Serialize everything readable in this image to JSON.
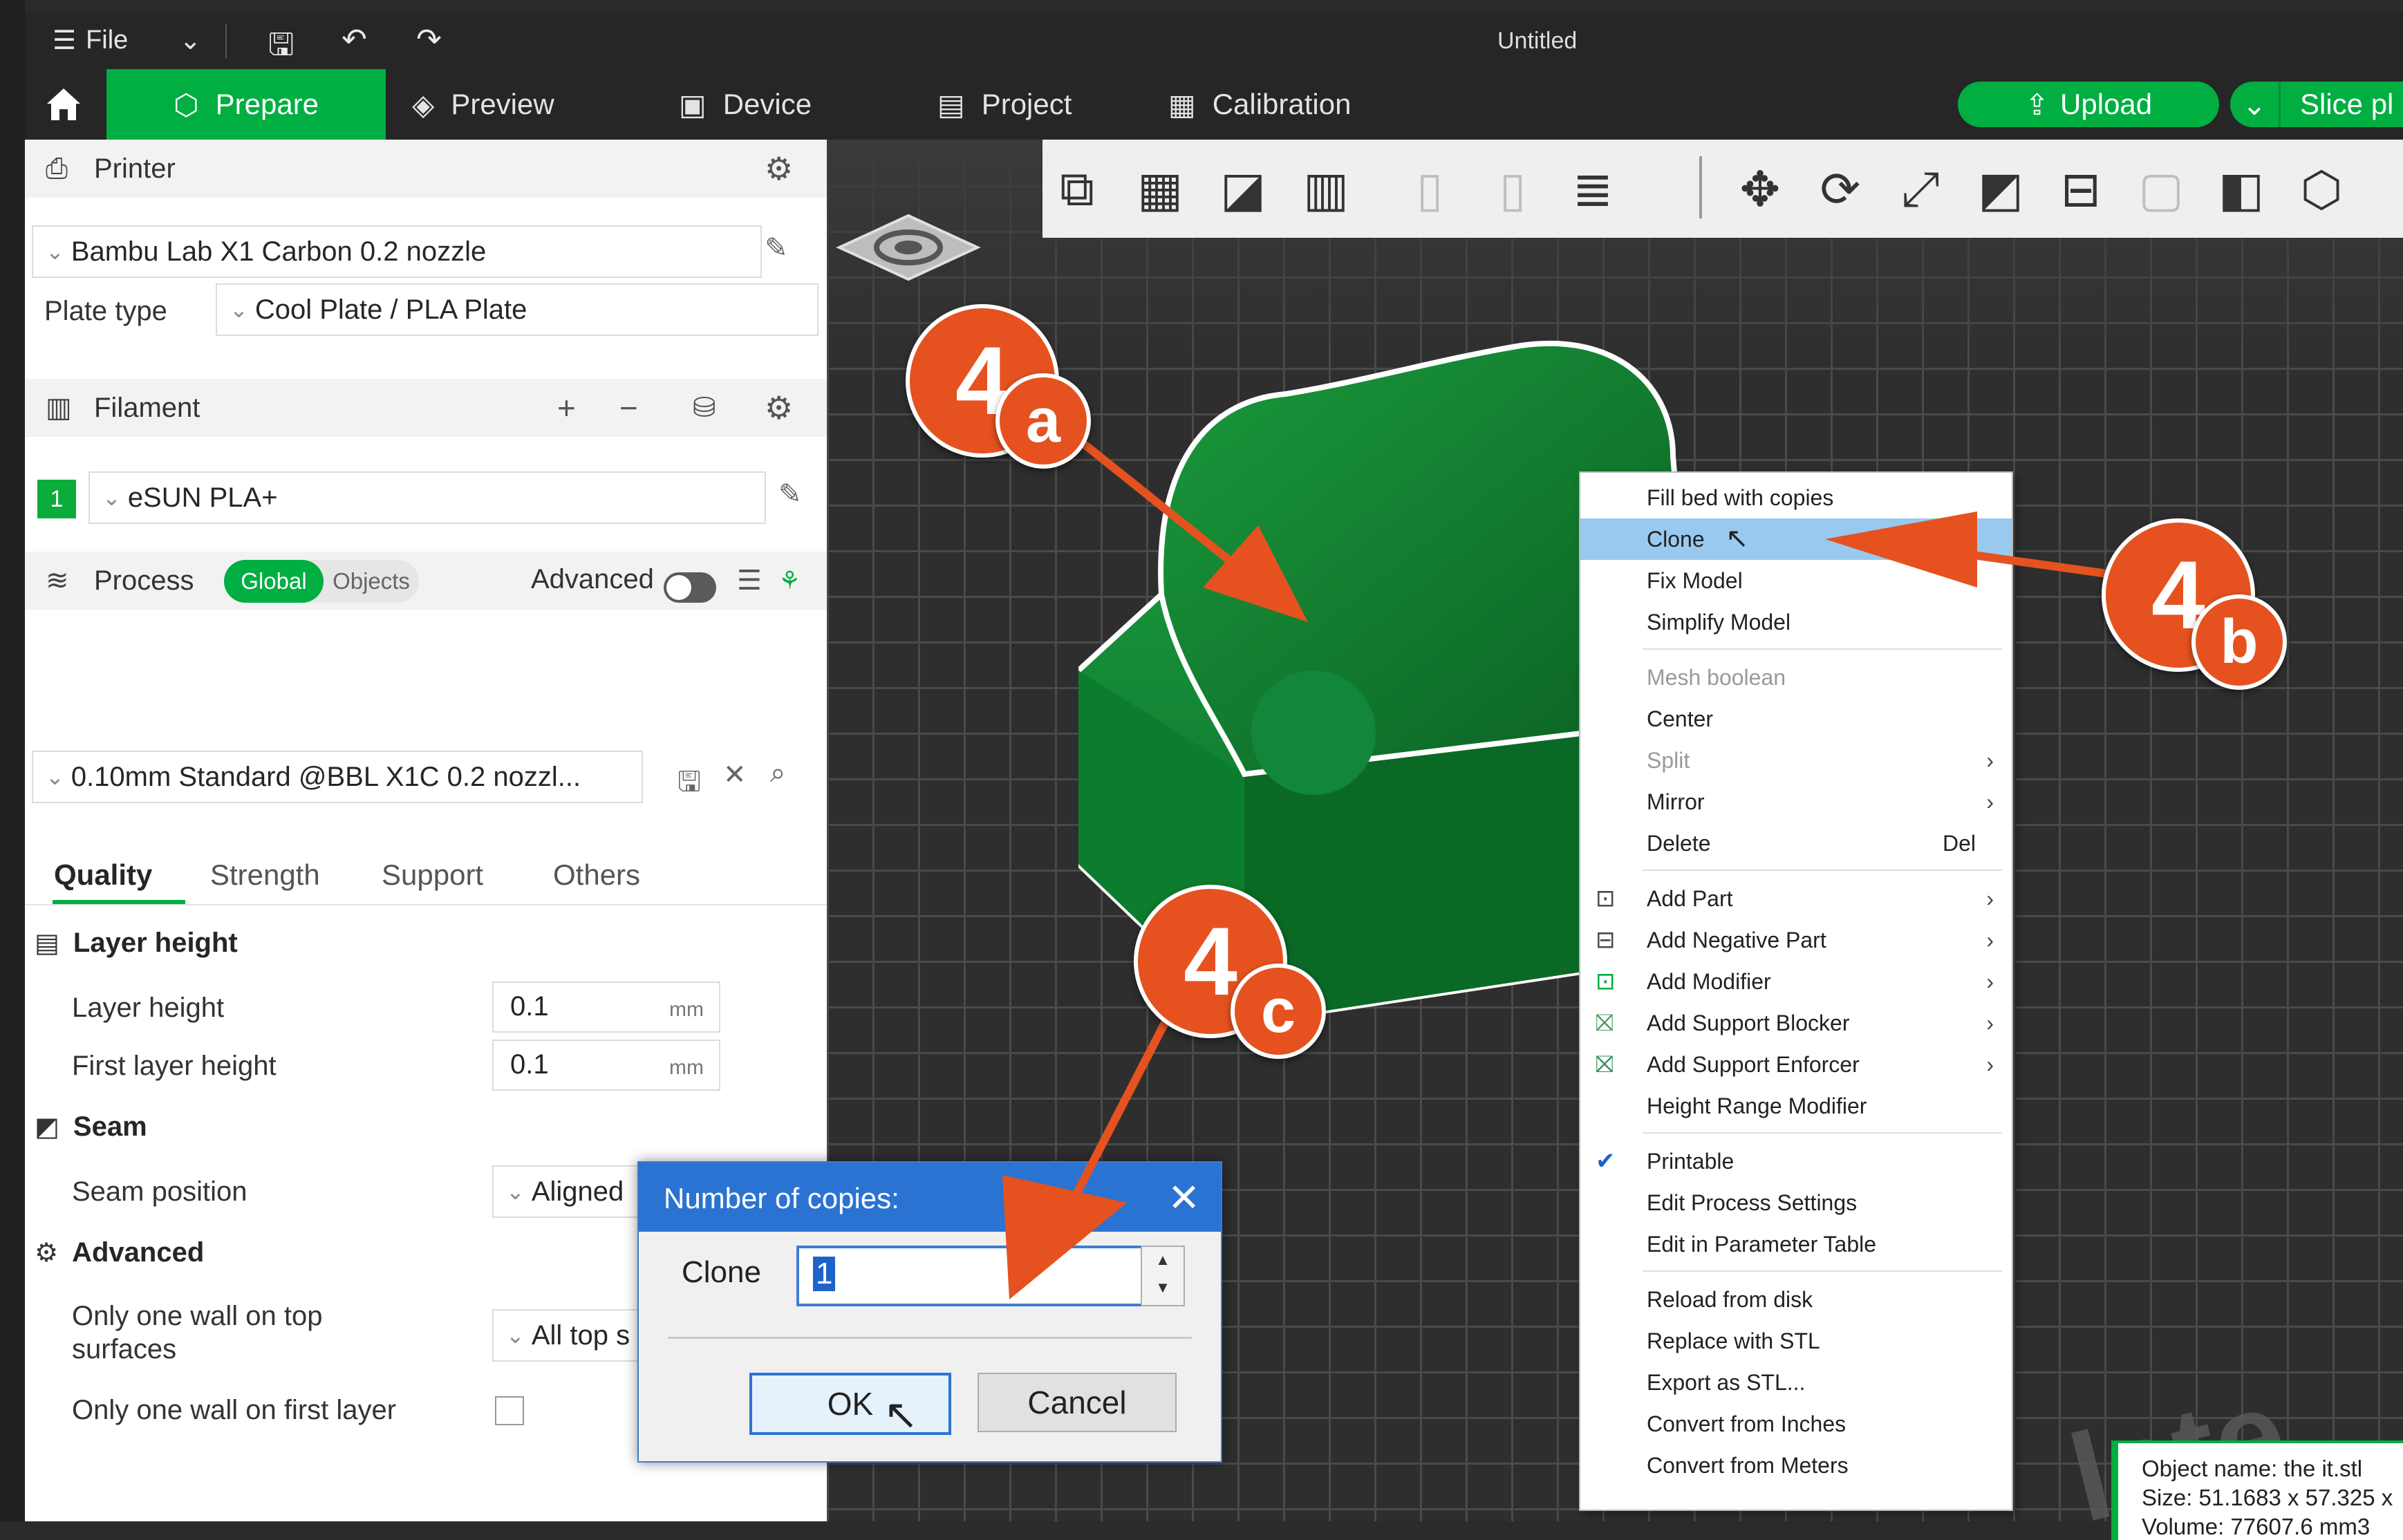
{
  "window": {
    "title": "Untitled",
    "menu_label": "File"
  },
  "tabs": [
    {
      "label": "Prepare"
    },
    {
      "label": "Preview"
    },
    {
      "label": "Device"
    },
    {
      "label": "Project"
    },
    {
      "label": "Calibration"
    }
  ],
  "actions": {
    "upload": "Upload",
    "slice": "Slice pl"
  },
  "printer": {
    "header": "Printer",
    "model": "Bambu Lab X1 Carbon 0.2 nozzle",
    "plate_type_label": "Plate type",
    "plate_type": "Cool Plate / PLA Plate"
  },
  "filament": {
    "header": "Filament",
    "slot": "1",
    "name": "eSUN PLA+"
  },
  "process": {
    "header": "Process",
    "toggle_global": "Global",
    "toggle_objects": "Objects",
    "advanced_label": "Advanced",
    "preset": "0.10mm Standard @BBL X1C 0.2 nozzl...",
    "tabs": [
      "Quality",
      "Strength",
      "Support",
      "Others"
    ],
    "layer_group": "Layer height",
    "layer_height_label": "Layer height",
    "layer_height": "0.1",
    "first_layer_label": "First layer height",
    "first_layer": "0.1",
    "unit": "mm",
    "seam_group": "Seam",
    "seam_label": "Seam position",
    "seam_value": "Aligned",
    "advanced_group": "Advanced",
    "one_wall_top_label_1": "Only one wall on top",
    "one_wall_top_label_2": "surfaces",
    "one_wall_top_value": "All top s",
    "one_wall_first_label": "Only one wall on first layer"
  },
  "context_menu": {
    "items": [
      {
        "label": "Fill bed with copies"
      },
      {
        "label": "Clone"
      },
      {
        "label": "Fix Model"
      },
      {
        "label": "Simplify Model"
      },
      {
        "label": "Mesh boolean"
      },
      {
        "label": "Center"
      },
      {
        "label": "Split",
        "arrow": "›"
      },
      {
        "label": "Mirror",
        "arrow": "›"
      },
      {
        "label": "Delete",
        "shortcut": "Del"
      },
      {
        "label": "Add Part",
        "arrow": "›"
      },
      {
        "label": "Add Negative Part",
        "arrow": "›"
      },
      {
        "label": "Add Modifier",
        "arrow": "›"
      },
      {
        "label": "Add Support Blocker",
        "arrow": "›"
      },
      {
        "label": "Add Support Enforcer",
        "arrow": "›"
      },
      {
        "label": "Height Range Modifier"
      },
      {
        "label": "Printable"
      },
      {
        "label": "Edit Process Settings"
      },
      {
        "label": "Edit in Parameter Table"
      },
      {
        "label": "Reload from disk"
      },
      {
        "label": "Replace with STL"
      },
      {
        "label": "Export as STL..."
      },
      {
        "label": "Convert from Inches"
      },
      {
        "label": "Convert from Meters"
      }
    ]
  },
  "dialog": {
    "title": "Number of copies:",
    "field_label": "Clone",
    "value": "1",
    "ok": "OK",
    "cancel": "Cancel"
  },
  "object_info": {
    "name_line": "Object name: the it.stl",
    "size_line": "Size: 51.1683 x 57.325 x",
    "volume_line": "Volume: 77607.6 mm3"
  },
  "plate_label": "late",
  "callouts": {
    "a_num": "4",
    "a_letter": "a",
    "b_num": "4",
    "b_letter": "b",
    "c_num": "4",
    "c_letter": "c"
  },
  "colors": {
    "accent": "#00ae42",
    "callout": "#e5521f",
    "highlight": "#99c9ef",
    "dialog_title": "#2b73d2",
    "model": "#0f7a2d"
  }
}
